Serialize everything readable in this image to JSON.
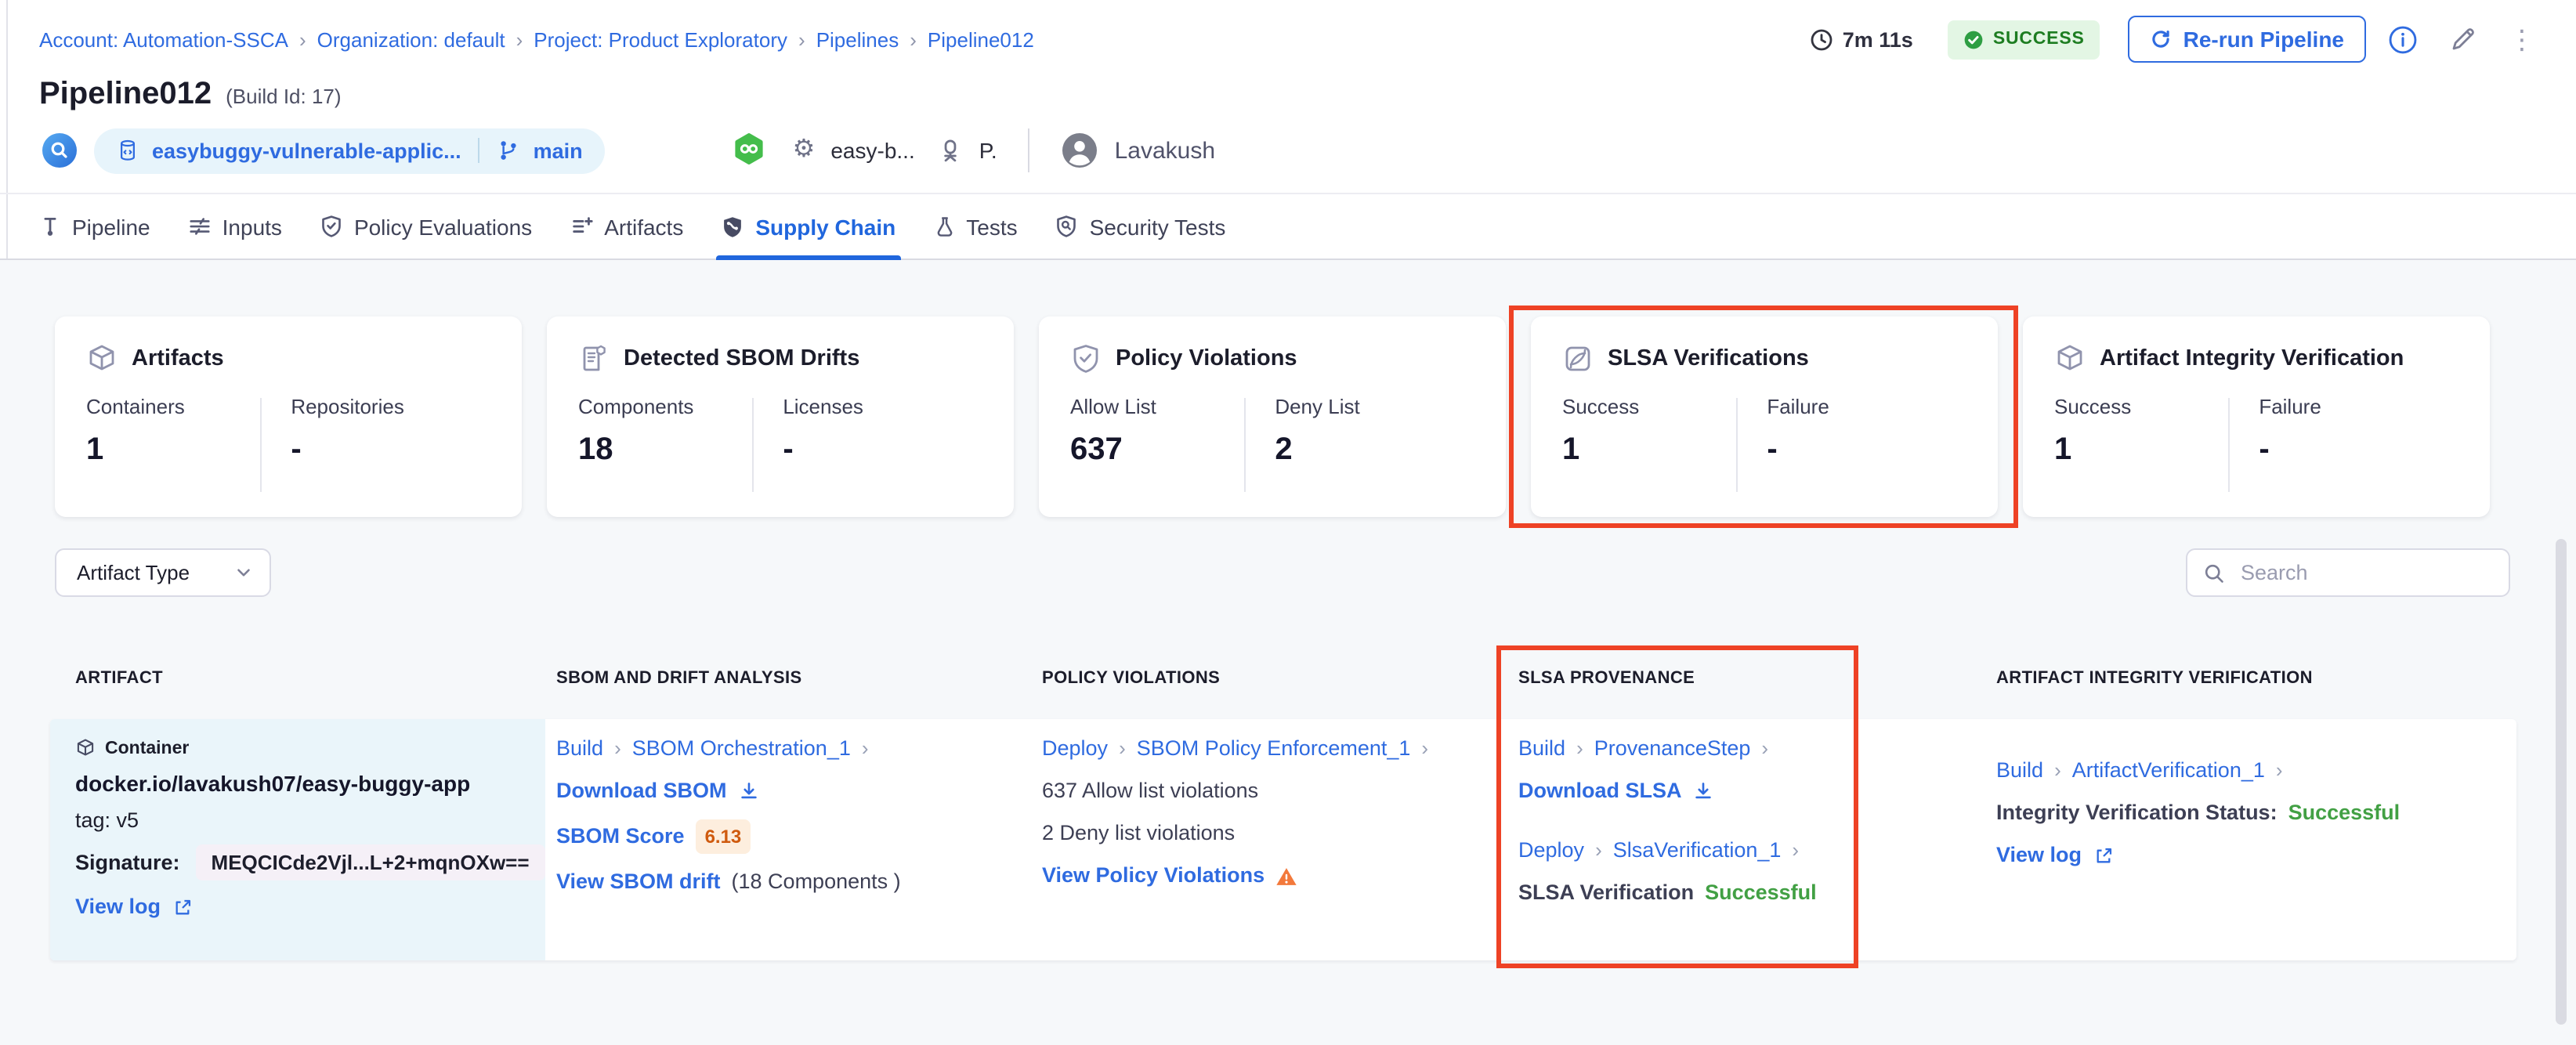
{
  "breadcrumb": {
    "items": [
      "Account: Automation-SSCA",
      "Organization: default",
      "Project: Product Exploratory",
      "Pipelines",
      "Pipeline012"
    ]
  },
  "header": {
    "title": "Pipeline012",
    "build_id": "(Build Id: 17)",
    "duration": "7m 11s",
    "status": "SUCCESS",
    "rerun_label": "Re-run Pipeline",
    "repo": "easybuggy-vulnerable-applic...",
    "branch": "main",
    "service": "easy-b...",
    "environment": "P.",
    "user": "Lavakush"
  },
  "tabs": [
    "Pipeline",
    "Inputs",
    "Policy Evaluations",
    "Artifacts",
    "Supply Chain",
    "Tests",
    "Security Tests"
  ],
  "active_tab": "Supply Chain",
  "summary_cards": [
    {
      "title": "Artifacts",
      "metrics": [
        {
          "label": "Containers",
          "value": "1"
        },
        {
          "label": "Repositories",
          "value": "-"
        }
      ]
    },
    {
      "title": "Detected SBOM Drifts",
      "metrics": [
        {
          "label": "Components",
          "value": "18"
        },
        {
          "label": "Licenses",
          "value": "-"
        }
      ]
    },
    {
      "title": "Policy Violations",
      "metrics": [
        {
          "label": "Allow List",
          "value": "637"
        },
        {
          "label": "Deny List",
          "value": "2"
        }
      ]
    },
    {
      "title": "SLSA Verifications",
      "highlighted": true,
      "metrics": [
        {
          "label": "Success",
          "value": "1"
        },
        {
          "label": "Failure",
          "value": "-"
        }
      ]
    },
    {
      "title": "Artifact Integrity Verification",
      "metrics": [
        {
          "label": "Success",
          "value": "1"
        },
        {
          "label": "Failure",
          "value": "-"
        }
      ]
    }
  ],
  "filters": {
    "artifact_type_label": "Artifact Type",
    "search_placeholder": "Search"
  },
  "table": {
    "columns": [
      "ARTIFACT",
      "SBOM AND DRIFT ANALYSIS",
      "POLICY VIOLATIONS",
      "SLSA PROVENANCE",
      "ARTIFACT INTEGRITY VERIFICATION"
    ],
    "row": {
      "artifact": {
        "type_badge": "Container",
        "image": "docker.io/lavakush07/easy-buggy-app",
        "tag": "tag: v5",
        "signature_label": "Signature:",
        "signature_value": "MEQCICde2Vjl...L+2+mqnOXw==",
        "view_log": "View log"
      },
      "sbom": {
        "stage": "Build",
        "step": "SBOM Orchestration_1",
        "download": "Download SBOM",
        "score_label": "SBOM Score",
        "score": "6.13",
        "drift_link": "View SBOM drift",
        "drift_info": "(18 Components )"
      },
      "policy": {
        "stage": "Deploy",
        "step": "SBOM Policy Enforcement_1",
        "allow": "637 Allow list violations",
        "deny": "2 Deny list violations",
        "view": "View Policy Violations"
      },
      "slsa": {
        "stage1": "Build",
        "step1": "ProvenanceStep",
        "download": "Download SLSA",
        "stage2": "Deploy",
        "step2": "SlsaVerification_1",
        "status_label": "SLSA Verification",
        "status_value": "Successful"
      },
      "integrity": {
        "stage": "Build",
        "step": "ArtifactVerification_1",
        "status_label": "Integrity Verification Status:",
        "status_value": "Successful",
        "view_log": "View log"
      }
    }
  },
  "icons": {
    "breadcrumb_separator": "›",
    "step_chevron": "›",
    "gear": "⚙",
    "kebab": "⋮"
  },
  "colors": {
    "accent_blue": "#2f6be0",
    "active_tab_blue": "#2066dd",
    "success_green": "#42a044",
    "success_badge_bg": "#e3f6e4",
    "warning_orange": "#f3793b",
    "highlight_red": "#ee4225",
    "score_orange": "#cf5a0e",
    "artifact_cell_bg": "#eaf5fa"
  }
}
